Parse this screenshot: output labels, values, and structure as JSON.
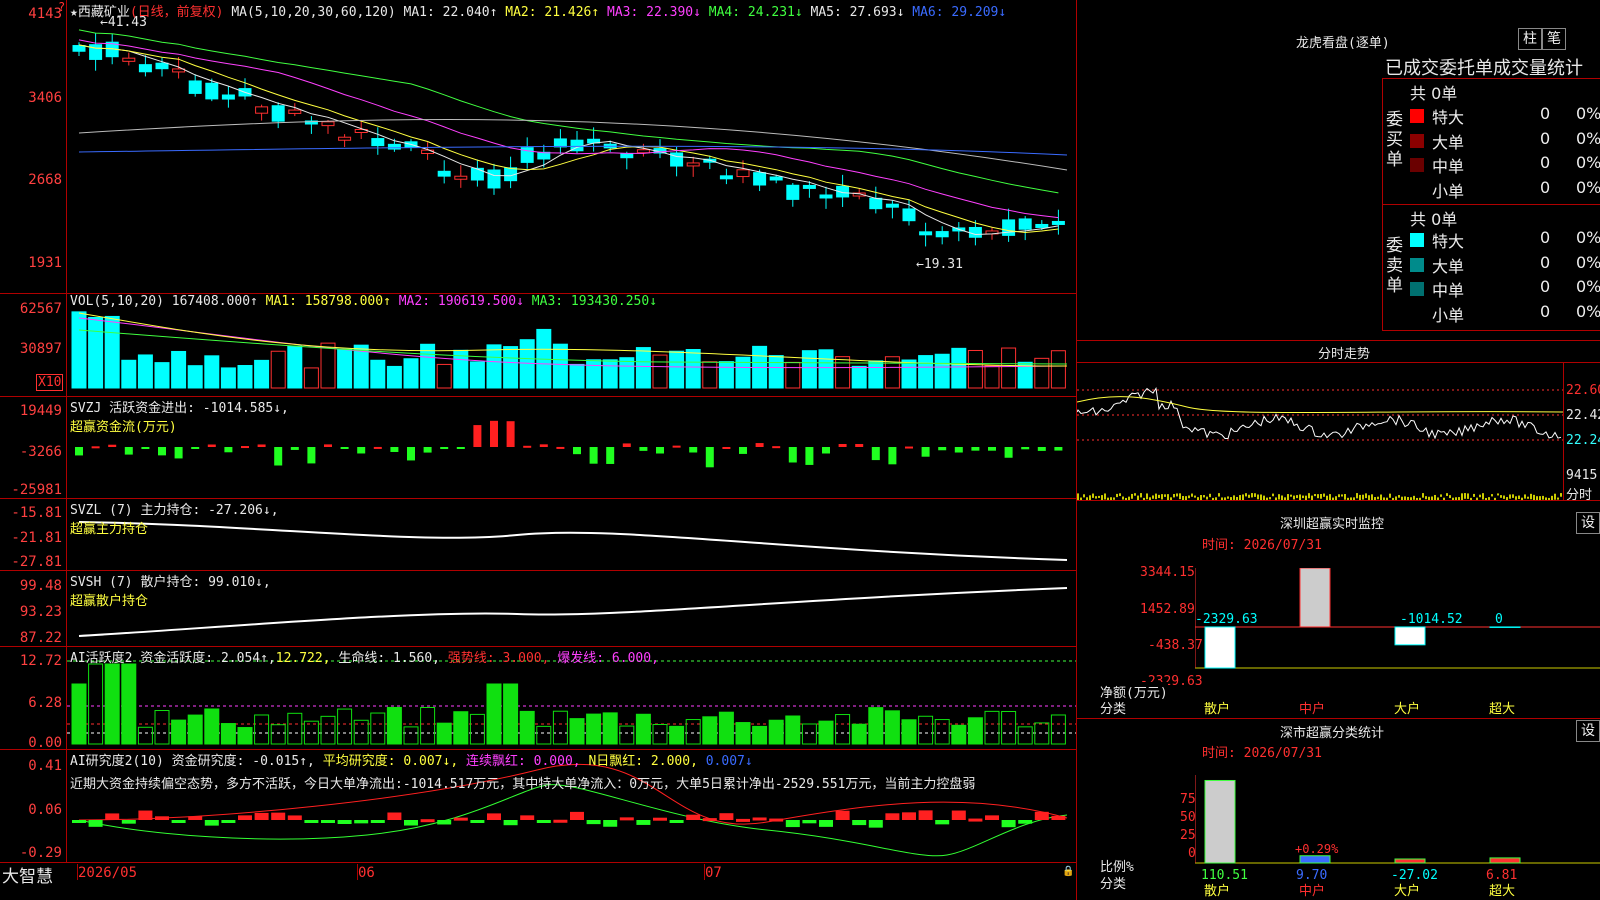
{
  "stock": {
    "star": "★",
    "name": "西藏矿业",
    "period": "(日线，前复权)"
  },
  "ma_main": {
    "label": "MA(5,10,20,30,60,120)",
    "ma1": "MA1: 22.040↑",
    "ma2": "MA2: 21.426↑",
    "ma3": "MA3: 22.390↓",
    "ma4": "MA4: 24.231↓",
    "ma5": "MA5: 27.693↓",
    "ma6": "MA6: 29.209↓"
  },
  "price_axis": {
    "top": "4143",
    "l1": "3406",
    "l2": "2668",
    "l3": "1931"
  },
  "price_marks": {
    "high": "41.43",
    "low": "19.31"
  },
  "vol": {
    "label": "VOL(5,10,20)",
    "value": "167408.000↑",
    "ma1": "MA1: 158798.000↑",
    "ma2": "MA2: 190619.500↓",
    "ma3": "MA3: 193430.250↓",
    "axis_top": "62567",
    "axis_mid": "30897",
    "unit": "X10"
  },
  "svzj": {
    "label": "SVZJ  活跃资金进出: -1014.585↓,",
    "sub": "超赢资金流(万元)",
    "a1": "19449",
    "a2": "-3266",
    "a3": "-25981"
  },
  "svzl": {
    "label": "SVZL (7) 主力持仓: -27.206↓,",
    "sub": "超赢主力持仓",
    "a1": "-15.81",
    "a2": "-21.81",
    "a3": "-27.81"
  },
  "svsh": {
    "label": "SVSH (7) 散户持仓: 99.010↓,",
    "sub": "超赢散户持仓",
    "a1": "99.48",
    "a2": "93.23",
    "a3": "87.22"
  },
  "ai1": {
    "label": "AI活跃度2 资金活跃度: 2.054↑,",
    "v2": "12.722,",
    "v3": "生命线: 1.560,",
    "v4": "强势线: 3.000,",
    "v5": "爆发线: 6.000,",
    "a1": "12.72",
    "a2": "6.28",
    "a3": "0.00"
  },
  "ai2": {
    "label": "AI研究度2(10) 资金研究度: -0.015↑,",
    "v2": "平均研究度: 0.007↓,",
    "v3": "连续飘红: 0.000,",
    "v4": "N日飘红: 2.000,",
    "v5": "0.007↓",
    "a1": "0.41",
    "a2": "0.06",
    "a3": "-0.29",
    "comment": "近期大资金持续偏空态势，多方不活跃，今日大单净流出:-1014.517万元，其中特大单净流入：0万元，大单5日累计净出-2529.551万元，当前主力控盘弱"
  },
  "xaxis": {
    "brand": "大智慧",
    "m1": "2026/05",
    "m2": "06",
    "m3": "07"
  },
  "lhb": {
    "title": "龙虎看盘(逐单)",
    "btn1": "柱",
    "btn2": "笔",
    "header": "已成交委托单成交量统计",
    "buy": {
      "side": "委买单",
      "total": "共 0单",
      "rows": [
        {
          "label": "特大",
          "count": "0",
          "pct": "0%"
        },
        {
          "label": "大单",
          "count": "0",
          "pct": "0%"
        },
        {
          "label": "中单",
          "count": "0",
          "pct": "0%"
        },
        {
          "label": "小单",
          "count": "0",
          "pct": "0%"
        }
      ]
    },
    "sell": {
      "side": "委卖单",
      "total": "共 0单",
      "rows": [
        {
          "label": "特大",
          "count": "0",
          "pct": "0%"
        },
        {
          "label": "大单",
          "count": "0",
          "pct": "0%"
        },
        {
          "label": "中单",
          "count": "0",
          "pct": "0%"
        },
        {
          "label": "小单",
          "count": "0",
          "pct": "0%"
        }
      ]
    }
  },
  "intraday": {
    "title": "分时走势",
    "p1": "22.60",
    "p2": "22.42",
    "p3": "22.24",
    "vol": "9415",
    "unit": "分时"
  },
  "sz_monitor": {
    "title": "深圳超赢实时监控",
    "btn": "设",
    "date": "时间: 2026/07/31",
    "axis": [
      "3344.15",
      "1452.89",
      "-438.37",
      "-2329.63"
    ],
    "ylabel": "净额(万元)",
    "xlabel": "分类",
    "cats": [
      "散户",
      "中户",
      "大户",
      "超大"
    ],
    "values": [
      "-2329.63",
      "3344.15",
      "-1014.52",
      "0"
    ]
  },
  "sz_stats": {
    "title": "深市超赢分类统计",
    "btn": "设",
    "date": "时间: 2026/07/31",
    "axis": [
      "75",
      "50",
      "25",
      "0"
    ],
    "ylabel": "比例%",
    "xlabel": "分类",
    "cats": [
      "散户",
      "中户",
      "大户",
      "超大"
    ],
    "values": [
      "110.51",
      "9.70",
      "-27.02",
      "6.81"
    ],
    "note": "+0.29%"
  }
}
